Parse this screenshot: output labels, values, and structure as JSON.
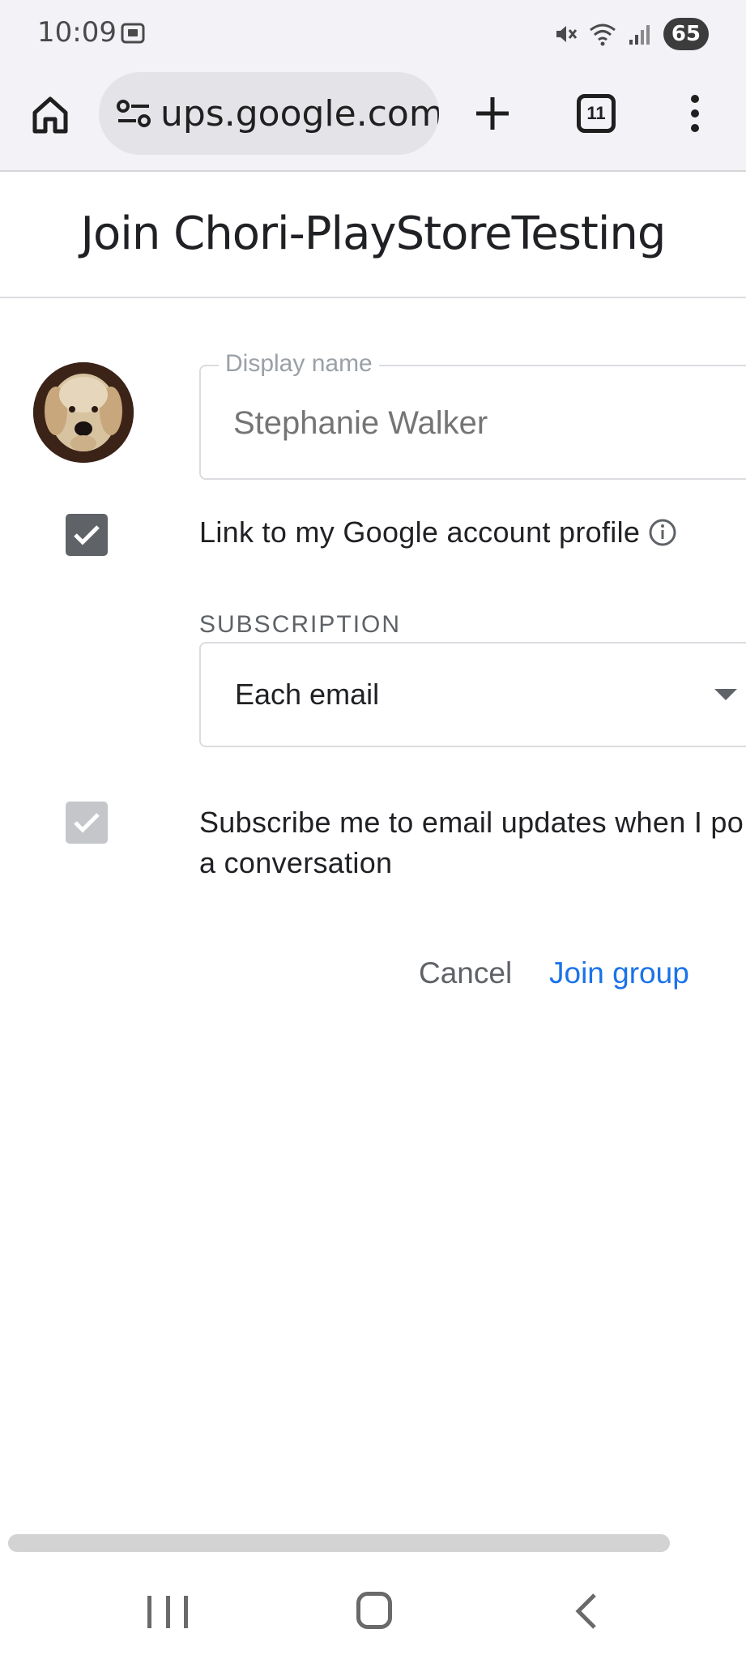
{
  "status_bar": {
    "time": "10:09",
    "battery": "65"
  },
  "browser": {
    "url": "ups.google.com",
    "tab_count": "11"
  },
  "page": {
    "title": "Join Chori-PlayStoreTesting"
  },
  "form": {
    "display_name_label": "Display name",
    "display_name_placeholder": "Stephanie Walker",
    "link_profile_label": "Link to my Google account profile",
    "link_profile_checked": true,
    "subscription_heading": "SUBSCRIPTION",
    "subscription_value": "Each email",
    "subscribe_updates_line1": "Subscribe me to email updates when I po",
    "subscribe_updates_line2": "a conversation",
    "subscribe_updates_checked": true,
    "subscribe_updates_disabled": true
  },
  "actions": {
    "cancel_label": "Cancel",
    "join_label": "Join group"
  },
  "colors": {
    "accent": "#1a73e8",
    "checkbox_on": "#5f6368",
    "checkbox_disabled": "#c4c6c9",
    "chrome_background": "#f2f2f7"
  }
}
